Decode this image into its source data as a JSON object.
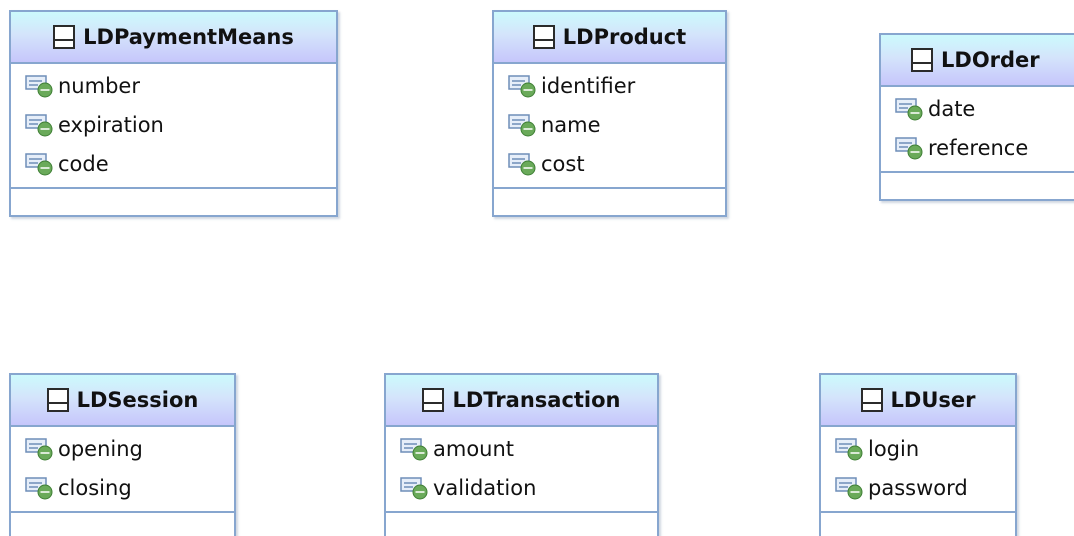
{
  "colors": {
    "border": "#87a6cf",
    "header_top": "#ccfafc",
    "header_bottom": "#c6c6fb",
    "attribute_badge": "#6aaa5a"
  },
  "classes": [
    {
      "name": "LDPaymentMeans",
      "icon": "class-icon",
      "attributes": [
        {
          "label": "number",
          "icon": "attribute-icon"
        },
        {
          "label": "expiration",
          "icon": "attribute-icon"
        },
        {
          "label": "code",
          "icon": "attribute-icon"
        }
      ]
    },
    {
      "name": "LDProduct",
      "icon": "class-icon",
      "attributes": [
        {
          "label": "identifier",
          "icon": "attribute-icon"
        },
        {
          "label": "name",
          "icon": "attribute-icon"
        },
        {
          "label": "cost",
          "icon": "attribute-icon"
        }
      ]
    },
    {
      "name": "LDOrder",
      "icon": "class-icon",
      "attributes": [
        {
          "label": "date",
          "icon": "attribute-icon"
        },
        {
          "label": "reference",
          "icon": "attribute-icon"
        }
      ]
    },
    {
      "name": "LDSession",
      "icon": "class-icon",
      "attributes": [
        {
          "label": "opening",
          "icon": "attribute-icon"
        },
        {
          "label": "closing",
          "icon": "attribute-icon"
        }
      ]
    },
    {
      "name": "LDTransaction",
      "icon": "class-icon",
      "attributes": [
        {
          "label": "amount",
          "icon": "attribute-icon"
        },
        {
          "label": "validation",
          "icon": "attribute-icon"
        }
      ]
    },
    {
      "name": "LDUser",
      "icon": "class-icon",
      "attributes": [
        {
          "label": "login",
          "icon": "attribute-icon"
        },
        {
          "label": "password",
          "icon": "attribute-icon"
        }
      ]
    }
  ]
}
